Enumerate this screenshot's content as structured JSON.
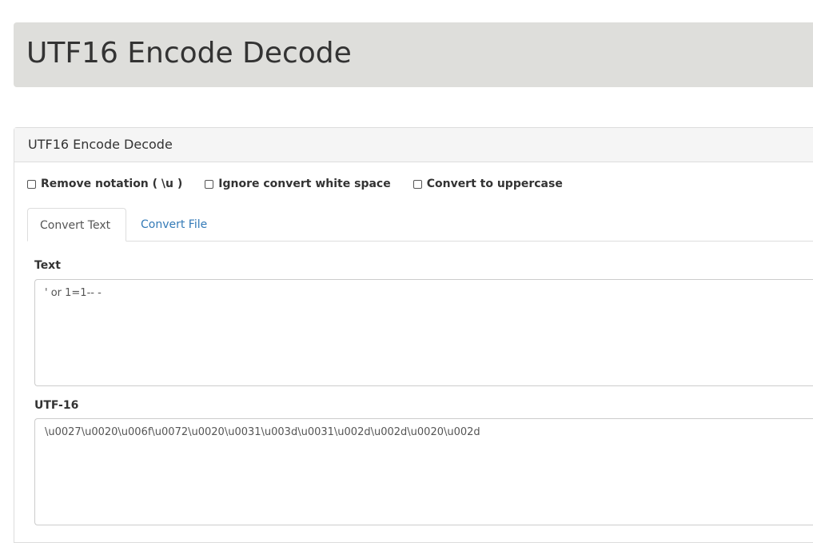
{
  "header": {
    "title": "UTF16 Encode Decode"
  },
  "panel": {
    "title": "UTF16 Encode Decode",
    "options": [
      {
        "label": "Remove notation ( \\u )",
        "checked": false
      },
      {
        "label": "Ignore convert white space",
        "checked": false
      },
      {
        "label": "Convert to uppercase",
        "checked": false
      }
    ],
    "tabs": [
      {
        "label": "Convert Text",
        "active": true
      },
      {
        "label": "Convert File",
        "active": false
      }
    ],
    "text_field": {
      "label": "Text",
      "value": "' or 1=1-- -"
    },
    "utf16_field": {
      "label": "UTF-16",
      "value": "\\u0027\\u0020\\u006f\\u0072\\u0020\\u0031\\u003d\\u0031\\u002d\\u002d\\u0020\\u002d"
    }
  },
  "colors": {
    "header_bg": "#dededb",
    "panel_heading_bg": "#f5f5f5",
    "link": "#337ab7",
    "border": "#dddddd"
  }
}
